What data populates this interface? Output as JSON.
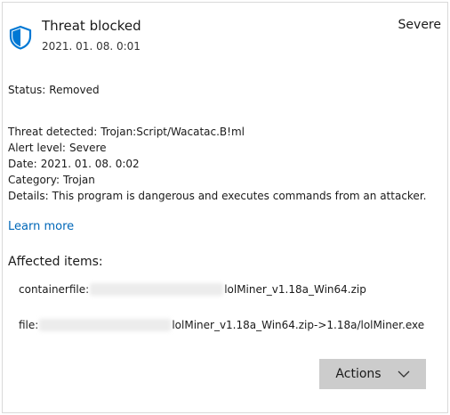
{
  "header": {
    "title": "Threat blocked",
    "date": "2021. 01. 08. 0:01",
    "severity": "Severe",
    "icon": "shield-icon"
  },
  "status": {
    "label": "Status:",
    "value": "Removed"
  },
  "details": [
    {
      "label": "Threat detected:",
      "value": "Trojan:Script/Wacatac.B!ml"
    },
    {
      "label": "Alert level:",
      "value": "Severe"
    },
    {
      "label": "Date:",
      "value": "2021. 01. 08. 0:02"
    },
    {
      "label": "Category:",
      "value": "Trojan"
    },
    {
      "label": "Details:",
      "value": "This program is dangerous and executes commands from an attacker."
    }
  ],
  "learn_more": "Learn more",
  "affected": {
    "heading": "Affected items:",
    "items": [
      {
        "prefix": "containerfile:",
        "suffix": "lolMiner_v1.18a_Win64.zip"
      },
      {
        "prefix": "file:",
        "suffix": "lolMiner_v1.18a_Win64.zip->1.18a/lolMiner.exe"
      }
    ]
  },
  "actions_button": "Actions",
  "colors": {
    "accent": "#0067b8",
    "button_bg": "#cccccc"
  }
}
